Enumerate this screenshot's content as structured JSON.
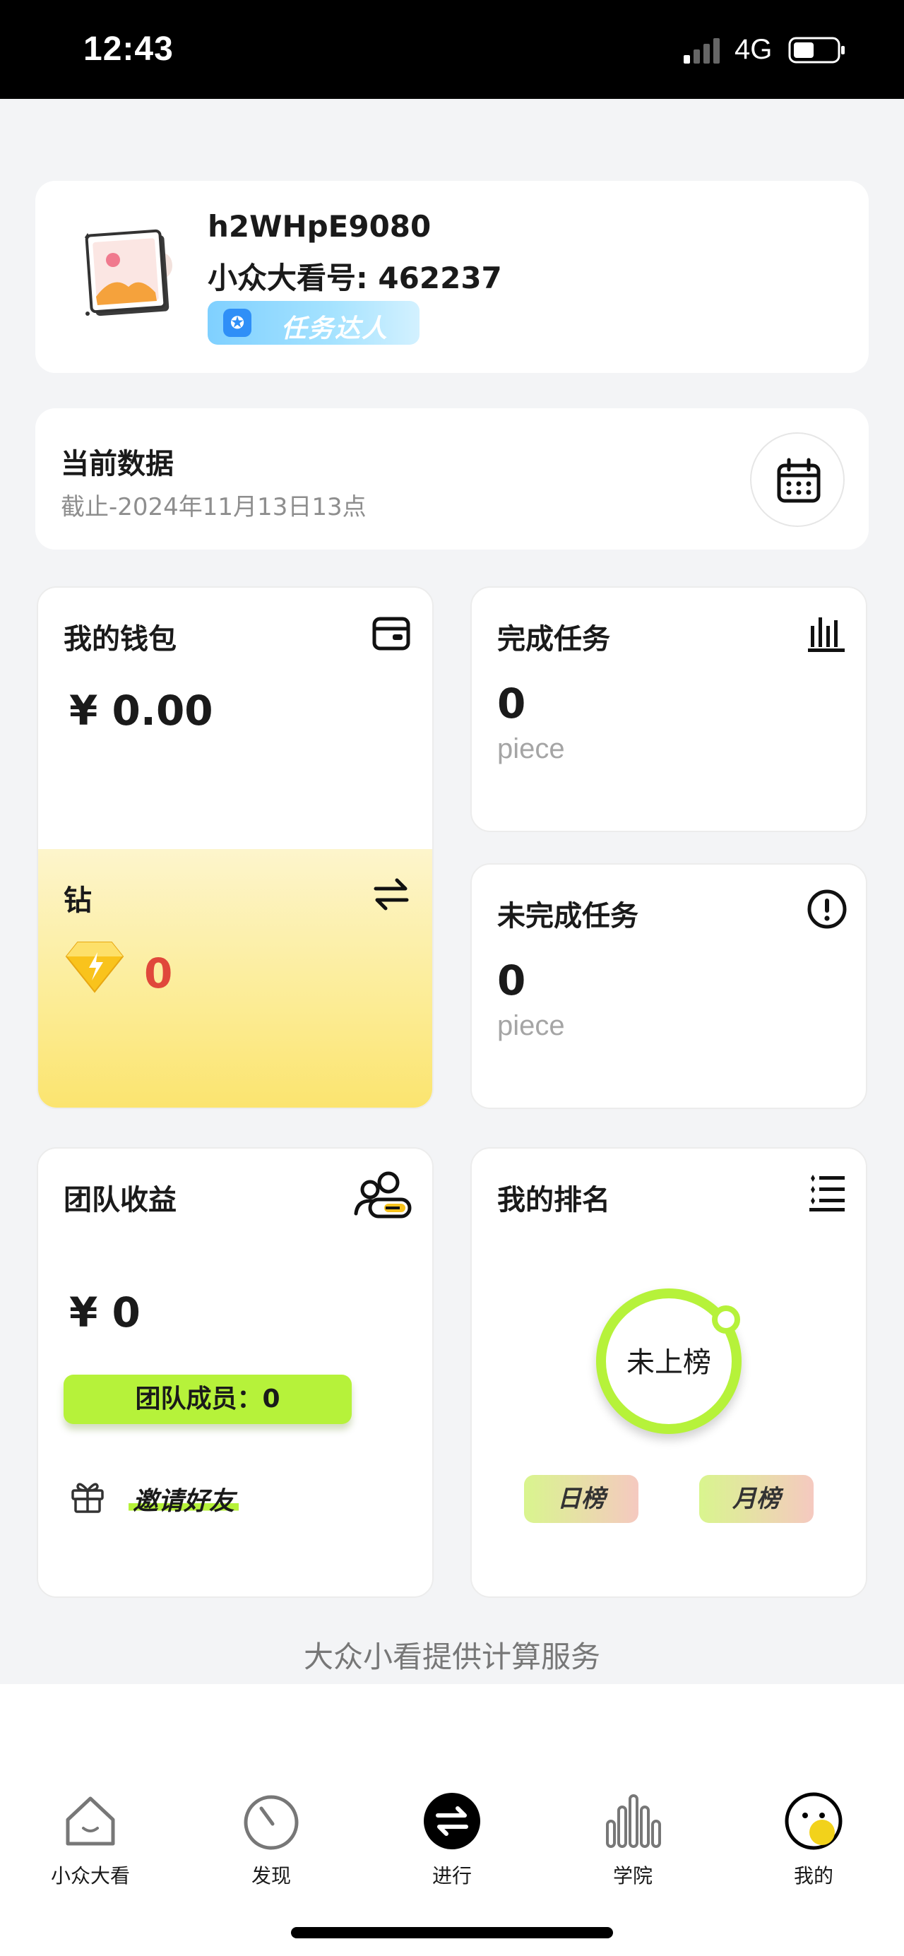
{
  "status_bar": {
    "time": "12:43",
    "network": "4G"
  },
  "profile": {
    "username": "h2WHpE9080",
    "account_id": "小众大看号: 462237",
    "badge": "任务达人"
  },
  "current_data": {
    "title": "当前数据",
    "subtitle": "截止-2024年11月13日13点"
  },
  "wallet": {
    "title": "我的钱包",
    "amount": "¥ 0.00",
    "diamond_label": "钻",
    "diamond_value": "0"
  },
  "completed_tasks": {
    "title": "完成任务",
    "value": "0",
    "unit": "piece"
  },
  "incomplete_tasks": {
    "title": "未完成任务",
    "value": "0",
    "unit": "piece"
  },
  "team": {
    "title": "团队收益",
    "amount": "¥ 0",
    "members": "团队成员：0",
    "invite": "邀请好友"
  },
  "ranking": {
    "title": "我的排名",
    "status": "未上榜",
    "daily": "日榜",
    "monthly": "月榜"
  },
  "footer_note": "大众小看提供计算服务",
  "tabs": [
    {
      "label": "小众大看",
      "icon": "home-icon"
    },
    {
      "label": "发现",
      "icon": "discover-icon"
    },
    {
      "label": "进行",
      "icon": "exchange-icon"
    },
    {
      "label": "学院",
      "icon": "academy-icon"
    },
    {
      "label": "我的",
      "icon": "profile-icon"
    }
  ],
  "colors": {
    "accent": "#b6f23a",
    "diamond_value": "#e0483b",
    "badge_blue": "#2f8ff7"
  }
}
